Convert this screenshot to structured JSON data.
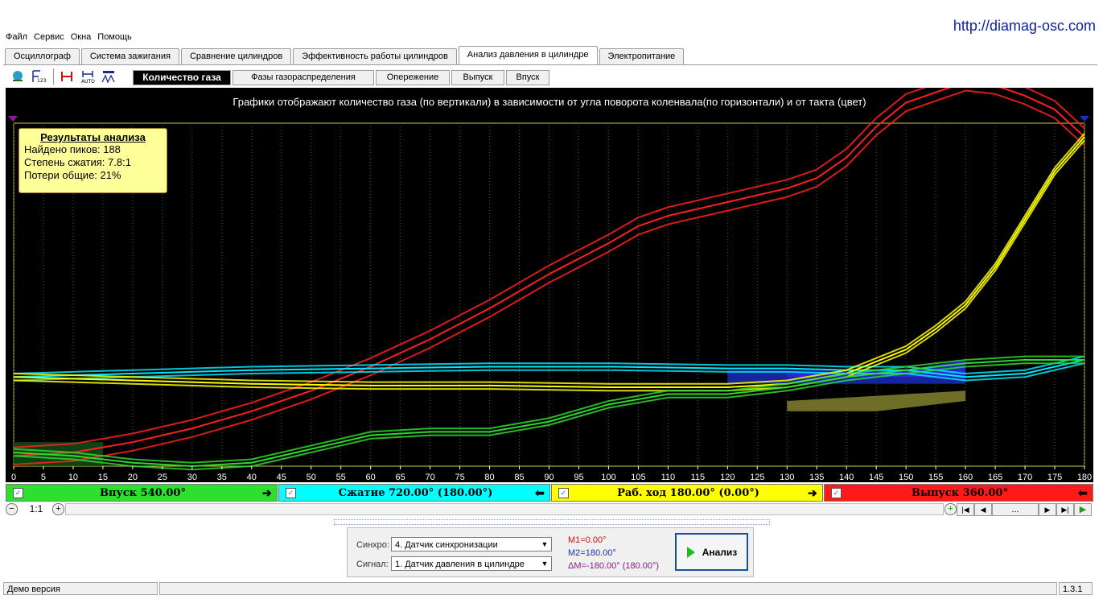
{
  "url": "http://diamag-osc.com",
  "menu": [
    "Файл",
    "Сервис",
    "Окна",
    "Помощь"
  ],
  "main_tabs": [
    "Осциллограф",
    "Система зажигания",
    "Сравнение цилиндров",
    "Эффективность работы цилиндров",
    "Анализ давления в цилиндре",
    "Электропитание"
  ],
  "active_main_tab": "Анализ давления в цилиндре",
  "sub_tabs": [
    "Количество газа",
    "Фазы газораспределения",
    "Опережение",
    "Выпуск",
    "Впуск"
  ],
  "active_sub_tab": "Количество газа",
  "chart_caption": "Графики отображают количество газа (по вертикали) в зависимости от угла поворота коленвала(по горизонтали) и от такта (цвет)",
  "results": {
    "title": "Результаты анализа",
    "peaks": "Найдено пиков: 188",
    "compression": "Степень сжатия: 7.8:1",
    "losses": "Потери общие: 21%"
  },
  "strokes": [
    {
      "label": "Впуск 540.00°",
      "color": "#2ee02e",
      "arrow": "➔"
    },
    {
      "label": "Сжатие 720.00° (180.00°)",
      "color": "#00ffff",
      "arrow": "⬅"
    },
    {
      "label": "Раб. ход 180.00° (0.00°)",
      "color": "#ffff00",
      "arrow": "➔"
    },
    {
      "label": "Выпуск 360.00°",
      "color": "#ff1a1a",
      "arrow": "⬅"
    }
  ],
  "zoom_label": "1:1",
  "nav_dots": "...",
  "sync_label": "Синхро:",
  "sync_value": "4.  Датчик синхронизации",
  "signal_label": "Сигнал:",
  "signal_value": "1.  Датчик давления в цилиндре",
  "markers": {
    "m1": "M1=0.00°",
    "m2": "M2=180.00°",
    "dm": "ΔM=-180.00° (180.00°)"
  },
  "analyze_label": "Анализ",
  "status_left": "Демо версия",
  "version": "1.3.1",
  "chart_data": {
    "type": "line",
    "title": "Графики отображают количество газа (по вертикали) в зависимости от угла поворота коленвала(по горизонтали) и от такта (цвет)",
    "xlabel": "",
    "ylabel": "",
    "xlim": [
      0,
      180
    ],
    "ylim": [
      0,
      100
    ],
    "x_ticks": [
      0,
      5,
      10,
      15,
      20,
      25,
      30,
      35,
      40,
      45,
      50,
      55,
      60,
      65,
      70,
      75,
      80,
      85,
      90,
      95,
      100,
      105,
      110,
      115,
      120,
      125,
      130,
      135,
      140,
      145,
      150,
      155,
      160,
      165,
      170,
      175,
      180
    ],
    "grid": true,
    "series": [
      {
        "color": "#ff2020",
        "x": [
          0,
          10,
          20,
          30,
          40,
          50,
          60,
          70,
          80,
          90,
          100,
          105,
          110,
          115,
          120,
          125,
          130,
          135,
          140,
          145,
          150,
          155,
          160,
          165,
          170,
          175,
          180
        ],
        "values": [
          3,
          4,
          7,
          11,
          16,
          22,
          29,
          37,
          46,
          56,
          65,
          70,
          73,
          75,
          77,
          79,
          81,
          84,
          90,
          99,
          106,
          109,
          112,
          111,
          108,
          104,
          96
        ]
      },
      {
        "color": "#00e8ff",
        "x": [
          0,
          20,
          40,
          60,
          80,
          100,
          120,
          130,
          140,
          150,
          160,
          170,
          180
        ],
        "values": [
          26,
          27,
          28,
          28.5,
          29,
          29,
          28.5,
          28.5,
          28,
          28,
          26,
          27,
          31
        ]
      },
      {
        "color": "#ffff00",
        "x": [
          0,
          20,
          40,
          60,
          80,
          100,
          120,
          130,
          140,
          150,
          155,
          160,
          165,
          170,
          175,
          180
        ],
        "values": [
          26,
          25,
          24,
          23.5,
          23.5,
          23,
          23,
          24,
          27,
          34,
          40,
          47,
          58,
          72,
          86,
          96
        ]
      },
      {
        "color": "#2ed82e",
        "x": [
          0,
          10,
          20,
          30,
          40,
          50,
          60,
          70,
          80,
          90,
          100,
          110,
          120,
          130,
          140,
          150,
          160,
          170,
          180
        ],
        "values": [
          4,
          3,
          1,
          0,
          1,
          5,
          9,
          10,
          10,
          13,
          18,
          21,
          21,
          23,
          26,
          28,
          30,
          31,
          31
        ]
      }
    ]
  }
}
